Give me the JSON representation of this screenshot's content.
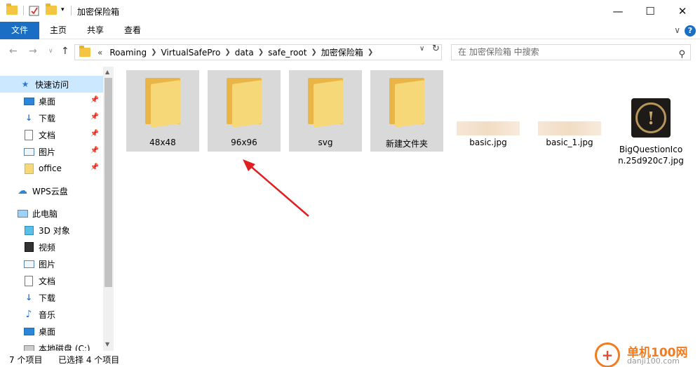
{
  "window": {
    "title": "加密保险箱",
    "minimize": "—",
    "maximize": "☐",
    "close": "✕"
  },
  "ribbon": {
    "tabs": [
      "文件",
      "主页",
      "共享",
      "查看"
    ],
    "expand": "∨",
    "help": "?"
  },
  "address": {
    "prefix": "«",
    "crumbs": [
      "Roaming",
      "VirtualSafePro",
      "data",
      "safe_root",
      "加密保险箱"
    ],
    "search_placeholder": "在 加密保险箱 中搜索"
  },
  "nav": {
    "items": [
      {
        "label": "快速访问",
        "icon": "star-icon",
        "selected": true
      },
      {
        "label": "桌面",
        "icon": "desktop-icon",
        "pinned": true
      },
      {
        "label": "下载",
        "icon": "download-icon",
        "pinned": true
      },
      {
        "label": "文档",
        "icon": "document-icon",
        "pinned": true
      },
      {
        "label": "图片",
        "icon": "picture-icon",
        "pinned": true
      },
      {
        "label": "office",
        "icon": "folder-icon",
        "pinned": true
      },
      {
        "label": "WPS云盘",
        "icon": "cloud-icon"
      },
      {
        "label": "此电脑",
        "icon": "computer-icon"
      },
      {
        "label": "3D 对象",
        "icon": "cube-icon"
      },
      {
        "label": "视频",
        "icon": "video-icon"
      },
      {
        "label": "图片",
        "icon": "picture-icon"
      },
      {
        "label": "文档",
        "icon": "document-icon"
      },
      {
        "label": "下载",
        "icon": "download-icon"
      },
      {
        "label": "音乐",
        "icon": "music-icon"
      },
      {
        "label": "桌面",
        "icon": "desktop-icon"
      },
      {
        "label": "本地磁盘 (C:)",
        "icon": "drive-icon"
      }
    ]
  },
  "files": [
    {
      "name": "48x48",
      "type": "folder",
      "selected": true
    },
    {
      "name": "96x96",
      "type": "folder",
      "selected": true
    },
    {
      "name": "svg",
      "type": "folder",
      "selected": true
    },
    {
      "name": "新建文件夹",
      "type": "folder",
      "selected": true
    },
    {
      "name": "basic.jpg",
      "type": "image"
    },
    {
      "name": "basic_1.jpg",
      "type": "image"
    },
    {
      "name": "BigQuestionIcon.25d920c7.jpg",
      "type": "image-dark"
    }
  ],
  "status": {
    "count": "7 个项目",
    "selected": "已选择 4 个项目"
  },
  "watermark": {
    "title": "单机100网",
    "subtitle": "danji100.com"
  }
}
